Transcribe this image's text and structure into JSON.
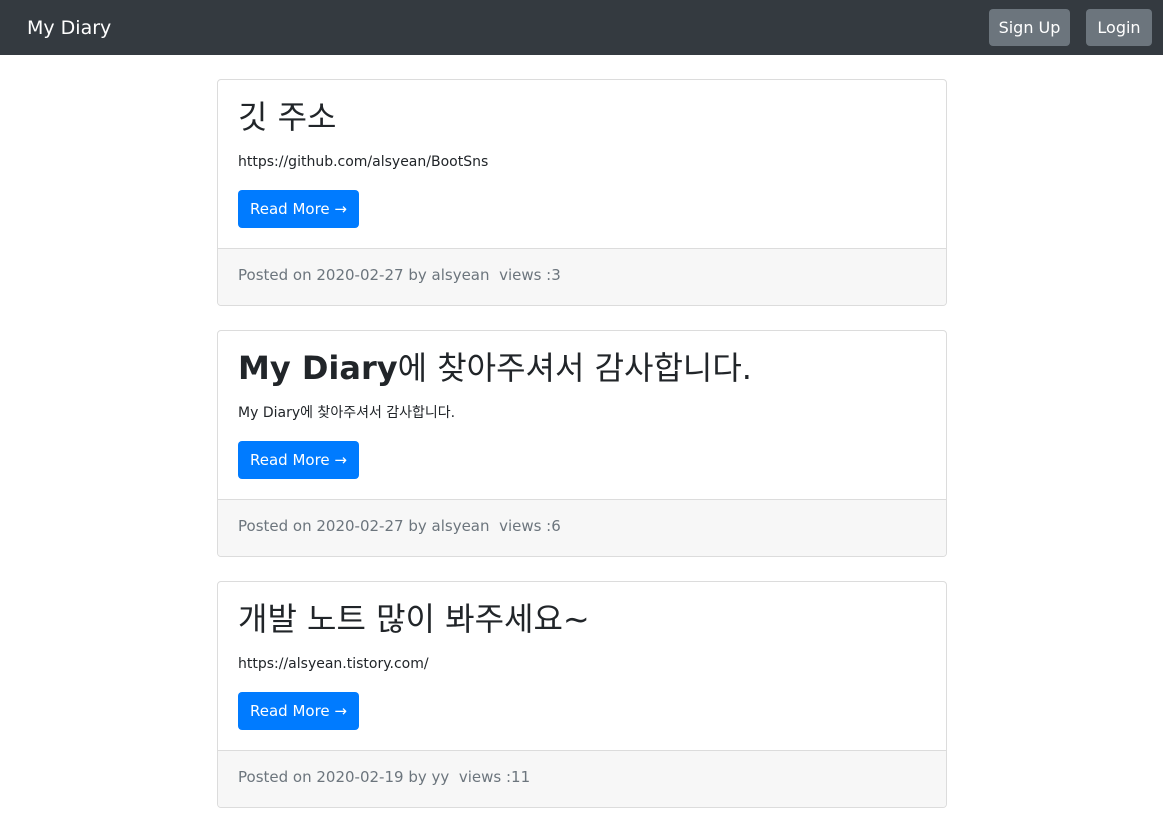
{
  "navbar": {
    "brand": "My Diary",
    "signup_label": "Sign Up",
    "login_label": "Login",
    "background_color": "#343a40",
    "button_color": "#6c757d"
  },
  "posts": [
    {
      "title": "깃 주소",
      "title_prefix_bold": "",
      "content": "https://github.com/alsyean/BootSns",
      "read_more_label": "Read More →",
      "posted_on_label": "Posted on",
      "date": "2020-02-27",
      "by_label": "by",
      "author": "alsyean",
      "views_label": "views :3"
    },
    {
      "title": "에 찾아주셔서 감사합니다.",
      "title_prefix_bold": "My Diary",
      "content": "My Diary에 찾아주셔서 감사합니다.",
      "read_more_label": "Read More →",
      "posted_on_label": "Posted on",
      "date": "2020-02-27",
      "by_label": "by",
      "author": "alsyean",
      "views_label": "views :6"
    },
    {
      "title": "개발 노트 많이 봐주세요~",
      "title_prefix_bold": "",
      "content": "https://alsyean.tistory.com/",
      "read_more_label": "Read More →",
      "posted_on_label": "Posted on",
      "date": "2020-02-19",
      "by_label": "by",
      "author": "yy",
      "views_label": "views :11"
    }
  ],
  "colors": {
    "primary": "#007bff",
    "footer_bg": "#f7f7f7",
    "muted_text": "#6c757d"
  }
}
